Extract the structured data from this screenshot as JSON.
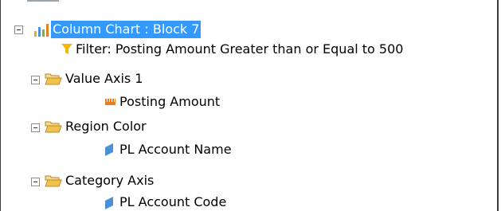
{
  "tree": {
    "root": {
      "label": "Column Chart : Block 7",
      "icon": "column-chart-icon"
    },
    "filter": {
      "label": "Filter: Posting Amount Greater than or Equal to 500",
      "icon": "filter-funnel-icon"
    },
    "folders": [
      {
        "label": "Value Axis 1",
        "icon": "folder-open-icon",
        "child": {
          "label": "Posting Amount",
          "icon": "measure-icon"
        }
      },
      {
        "label": "Region Color",
        "icon": "folder-open-icon",
        "child": {
          "label": "PL Account Name",
          "icon": "dimension-icon"
        }
      },
      {
        "label": "Category Axis",
        "icon": "folder-open-icon",
        "child": {
          "label": "PL Account Code",
          "icon": "dimension-icon"
        }
      }
    ]
  },
  "colors": {
    "selection": "#3399ff",
    "folder": "#f2c14e",
    "filter": "#f5b800",
    "measure": "#e67e22",
    "dimension": "#4a90d9"
  }
}
